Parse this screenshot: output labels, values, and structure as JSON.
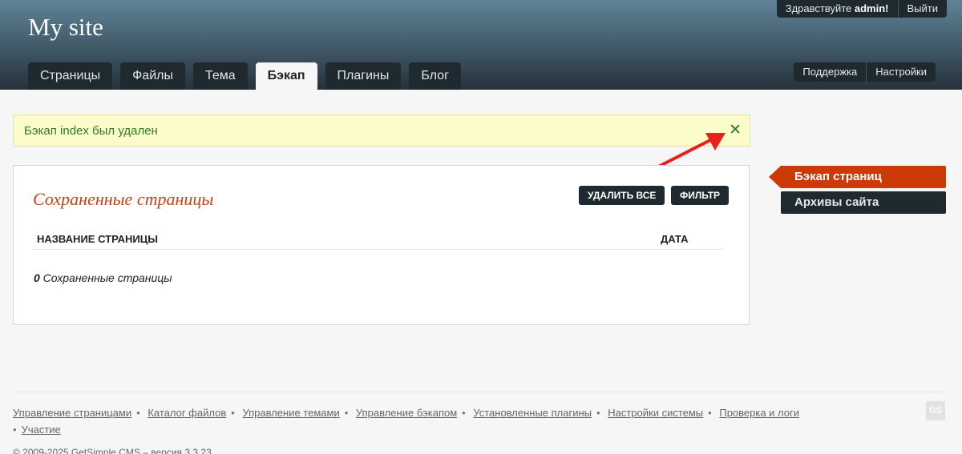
{
  "header": {
    "site_title": "My site",
    "tabs": [
      {
        "label": "Страницы"
      },
      {
        "label": "Файлы"
      },
      {
        "label": "Тема"
      },
      {
        "label": "Бэкап"
      },
      {
        "label": "Плагины"
      },
      {
        "label": "Блог"
      }
    ],
    "active_tab": "Бэкап",
    "greeting_prefix": "Здравствуйте ",
    "username": "admin!",
    "logout_label": "Выйти",
    "support_label": "Поддержка",
    "settings_label": "Настройки"
  },
  "notice": {
    "text": "Бэкап index был удален",
    "close_glyph": "✕"
  },
  "panel": {
    "title": "Сохраненные страницы",
    "delete_all_label": "УДАЛИТЬ ВСЕ",
    "filter_label": "ФИЛЬТР",
    "col_name": "НАЗВАНИЕ СТРАНИЦЫ",
    "col_date": "ДАТА",
    "count_number": "0",
    "count_text": " Сохраненные страницы"
  },
  "sidebar": {
    "items": [
      {
        "label": "Бэкап страниц"
      },
      {
        "label": "Архивы сайта"
      }
    ]
  },
  "footer": {
    "links": [
      {
        "label": "Управление страницами"
      },
      {
        "label": "Каталог файлов"
      },
      {
        "label": "Управление темами"
      },
      {
        "label": "Управление бэкапом"
      },
      {
        "label": "Установленные плагины"
      },
      {
        "label": "Настройки системы"
      },
      {
        "label": "Проверка и логи"
      },
      {
        "label": "Участие"
      }
    ],
    "separator": "•",
    "copyright": "© 2009-2025 GetSimple CMS – версия 3.3.23",
    "logo_text": "GS"
  },
  "colors": {
    "accent": "#cc3a07",
    "dark": "#1f2a30",
    "annotation_arrow": "#e8201b"
  }
}
